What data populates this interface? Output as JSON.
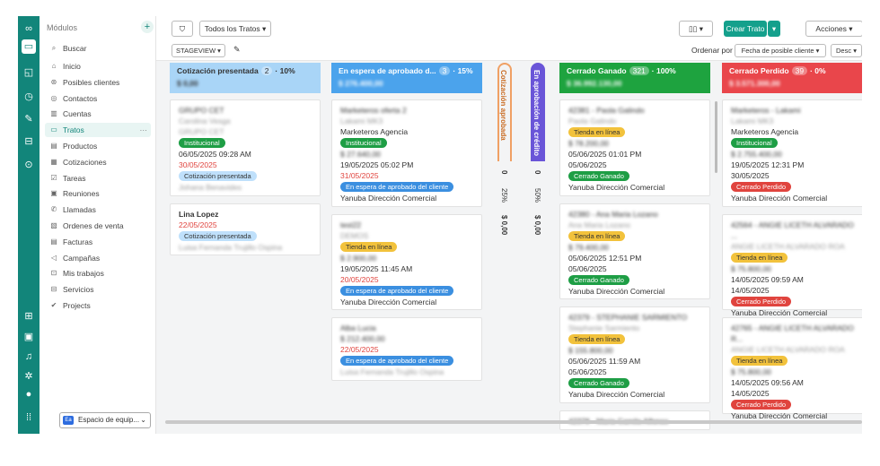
{
  "rail": {
    "icons": [
      "logo-icon",
      "deals-icon",
      "reports-icon",
      "clock-icon",
      "chat-icon",
      "mail-icon",
      "search-icon",
      "add-note-icon",
      "calendar-icon",
      "bell-icon",
      "settings-icon",
      "avatar",
      "apps-grid-icon"
    ]
  },
  "sidebar": {
    "title": "Módulos",
    "search": "Buscar",
    "items": [
      {
        "label": "Inicio",
        "icon": "home-icon"
      },
      {
        "label": "Posibles clientes",
        "icon": "leads-icon"
      },
      {
        "label": "Contactos",
        "icon": "contacts-icon"
      },
      {
        "label": "Cuentas",
        "icon": "accounts-icon"
      },
      {
        "label": "Tratos",
        "icon": "deals-icon"
      },
      {
        "label": "Productos",
        "icon": "products-icon"
      },
      {
        "label": "Cotizaciones",
        "icon": "quotes-icon"
      },
      {
        "label": "Tareas",
        "icon": "tasks-icon"
      },
      {
        "label": "Reuniones",
        "icon": "meetings-icon"
      },
      {
        "label": "Llamadas",
        "icon": "calls-icon"
      },
      {
        "label": "Ordenes de venta",
        "icon": "orders-icon"
      },
      {
        "label": "Facturas",
        "icon": "invoices-icon"
      },
      {
        "label": "Campañas",
        "icon": "campaigns-icon"
      },
      {
        "label": "Mis trabajos",
        "icon": "jobs-icon"
      },
      {
        "label": "Servicios",
        "icon": "services-icon"
      },
      {
        "label": "Projects",
        "icon": "projects-icon"
      }
    ],
    "workspace_badge": "Ea",
    "workspace": "Espacio de equip..."
  },
  "toolbar": {
    "filter_view": "Todos los Tratos",
    "create": "Crear Trato",
    "actions": "Acciones",
    "stageview": "STAGEVIEW",
    "order_by": "Ordenar por",
    "order_field": "Fecha de posible cliente",
    "order_dir": "Desc"
  },
  "columns": [
    {
      "title": "Cotización presentada",
      "count": "2",
      "pct": "10%",
      "amount": "$ 0,00",
      "color": "#a9d5f7",
      "text": "#333",
      "cards": [
        {
          "name": "GRUPO CET",
          "contact": "Carolina Vesga",
          "company": "GRUPO CET",
          "tag": "Institucional",
          "tagc": "t-green",
          "date1": "06/05/2025 09:28 AM",
          "date2": "30/05/2025",
          "date2c": "red",
          "stage": "Cotización presentada",
          "stagec": "t-lblue",
          "owner": "Johana Benavides"
        },
        {
          "name": "Lina Lopez",
          "date2": "22/05/2025",
          "date2c": "red",
          "stage": "Cotización presentada",
          "stagec": "t-lblue",
          "owner": "Luisa Fernanda Trujillo Ospina"
        }
      ]
    },
    {
      "title": "En espera de aprobado d...",
      "count": "3",
      "pct": "15%",
      "amount": "$ 276.400,00",
      "color": "#4ba3ec",
      "text": "#fff",
      "cards": [
        {
          "name": "Marketeros oferta 2",
          "contact": "Lakami MK3",
          "company": "Marketeros Agencia",
          "tag": "Institucional",
          "tagc": "t-green",
          "price": "$ 27.640,00",
          "date1": "19/05/2025 05:02 PM",
          "date2": "31/05/2025",
          "date2c": "red",
          "stage": "En espera de aprobado del cliente",
          "stagec": "t-blue",
          "owner": "Yanuba Dirección Comercial"
        },
        {
          "name": "test22",
          "contact": "DEMOS",
          "tag": "Tienda en línea",
          "tagc": "t-yellow",
          "price": "$ 2.900,00",
          "date1": "19/05/2025 11:45 AM",
          "date2": "20/05/2025",
          "date2c": "red",
          "stage": "En espera de aprobado del cliente",
          "stagec": "t-blue",
          "owner": "Yanuba Dirección Comercial"
        },
        {
          "name": "Alba Lucia",
          "price": "$ 212.400,00",
          "date2": "22/05/2025",
          "date2c": "red",
          "stage": "En espera de aprobado del cliente",
          "stagec": "t-blue",
          "owner": "Luisa Fernanda Trujillo Ospina"
        }
      ]
    },
    {
      "title": "Cerrado Ganado",
      "count": "321",
      "pct": "100%",
      "amount": "$ 36.992.130,00",
      "color": "#1ea33f",
      "text": "#fff",
      "cards": [
        {
          "name": "42381 - Paola Galindo",
          "contact": "Paola Galindo",
          "tag": "Tienda en línea",
          "tagc": "t-yellow",
          "price": "$ 78.200,00",
          "date1": "05/06/2025 01:01 PM",
          "date2": "05/06/2025",
          "stage": "Cerrado Ganado",
          "stagec": "t-green",
          "owner": "Yanuba Dirección Comercial"
        },
        {
          "name": "42380 - Ana Maria Lozano",
          "contact": "Ana Maria Lozano",
          "tag": "Tienda en línea",
          "tagc": "t-yellow",
          "price": "$ 79.400,00",
          "date1": "05/06/2025 12:51 PM",
          "date2": "05/06/2025",
          "stage": "Cerrado Ganado",
          "stagec": "t-green",
          "owner": "Yanuba Dirección Comercial"
        },
        {
          "name": "42379 - STEPHANIE SARMIENTO",
          "contact": "Stephanie Sarmiento",
          "tag": "Tienda en línea",
          "tagc": "t-yellow",
          "price": "$ 155.800,00",
          "date1": "05/06/2025 11:59 AM",
          "date2": "05/06/2025",
          "stage": "Cerrado Ganado",
          "stagec": "t-green",
          "owner": "Yanuba Dirección Comercial"
        },
        {
          "name": "42378 - Maria Camila Alfonso"
        }
      ]
    },
    {
      "title": "Cerrado Perdido",
      "count": "39",
      "pct": "0%",
      "amount": "$ 3.571.300,00",
      "color": "#e9464b",
      "text": "#fff",
      "cards": [
        {
          "name": "Marketeros - Lakami",
          "contact": "Lakami MK3",
          "company": "Marketeros Agencia",
          "tag": "Institucional",
          "tagc": "t-green",
          "price": "$ 2.755.400,00",
          "date1": "19/05/2025 12:31 PM",
          "date2": "30/05/2025",
          "stage": "Cerrado Perdido",
          "stagec": "t-red",
          "owner": "Yanuba Dirección Comercial"
        },
        {
          "name": "42564 - ANGIE LICETH ALVARADO ...",
          "contact": "ANGIE LICETH ALVARADO ROA",
          "tag": "Tienda en línea",
          "tagc": "t-yellow",
          "price": "$ 75.800,00",
          "date1": "14/05/2025 09:59 AM",
          "date2": "14/05/2025",
          "stage": "Cerrado Perdido",
          "stagec": "t-red",
          "owner": "Yanuba Dirección Comercial"
        },
        {
          "name": "42765 - ANGIE LICETH ALVARADO R...",
          "contact": "ANGIE LICETH ALVARADO ROA",
          "tag": "Tienda en línea",
          "tagc": "t-yellow",
          "price": "$ 75.800,00",
          "date1": "14/05/2025 09:56 AM",
          "date2": "14/05/2025",
          "stage": "Cerrado Perdido",
          "stagec": "t-red",
          "owner": "Yanuba Dirección Comercial"
        }
      ]
    }
  ],
  "vcols": [
    {
      "title": "Cotización aprobada",
      "count": "0",
      "pct": "25%",
      "amount": "$ 0,00",
      "color": "#f0a064"
    },
    {
      "title": "En aprobación de crédito",
      "count": "0",
      "pct": "50%",
      "amount": "$ 0,00",
      "color": "#6a55d8"
    }
  ]
}
